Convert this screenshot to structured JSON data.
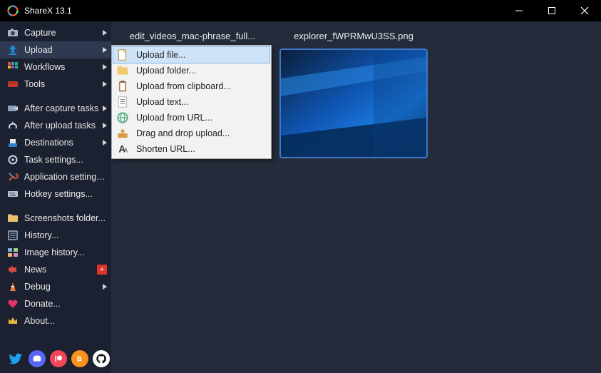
{
  "window": {
    "title": "ShareX 13.1"
  },
  "sidebar": {
    "items": [
      {
        "label": "Capture",
        "icon": "camera-icon",
        "submenu": true
      },
      {
        "label": "Upload",
        "icon": "upload-icon",
        "submenu": true,
        "selected": true
      },
      {
        "label": "Workflows",
        "icon": "workflows-icon",
        "submenu": true
      },
      {
        "label": "Tools",
        "icon": "tools-icon",
        "submenu": true
      }
    ],
    "items2": [
      {
        "label": "After capture tasks",
        "icon": "after-capture-icon",
        "submenu": true
      },
      {
        "label": "After upload tasks",
        "icon": "after-upload-icon",
        "submenu": true
      },
      {
        "label": "Destinations",
        "icon": "destinations-icon",
        "submenu": true
      },
      {
        "label": "Task settings...",
        "icon": "task-settings-icon"
      },
      {
        "label": "Application settings...",
        "icon": "app-settings-icon"
      },
      {
        "label": "Hotkey settings...",
        "icon": "hotkey-settings-icon"
      }
    ],
    "items3": [
      {
        "label": "Screenshots folder...",
        "icon": "folder-icon"
      },
      {
        "label": "History...",
        "icon": "history-icon"
      },
      {
        "label": "Image history...",
        "icon": "image-history-icon"
      },
      {
        "label": "News",
        "icon": "news-icon",
        "badge": "+"
      },
      {
        "label": "Debug",
        "icon": "debug-icon",
        "submenu": true
      },
      {
        "label": "Donate...",
        "icon": "heart-icon"
      },
      {
        "label": "About...",
        "icon": "crown-icon"
      }
    ]
  },
  "submenu": {
    "items": [
      {
        "label": "Upload file...",
        "icon": "file-icon",
        "hover": true
      },
      {
        "label": "Upload folder...",
        "icon": "folder-icon"
      },
      {
        "label": "Upload from clipboard...",
        "icon": "clipboard-icon"
      },
      {
        "label": "Upload text...",
        "icon": "text-icon"
      },
      {
        "label": "Upload from URL...",
        "icon": "url-icon"
      },
      {
        "label": "Drag and drop upload...",
        "icon": "drag-icon"
      },
      {
        "label": "Shorten URL...",
        "icon": "shorten-icon"
      }
    ]
  },
  "files": [
    {
      "name": "edit_videos_mac-phrase_full..."
    },
    {
      "name": "explorer_fWPRMwU3SS.png",
      "selected": true
    }
  ],
  "social": [
    "twitter",
    "discord",
    "patreon",
    "bitcoin",
    "github"
  ],
  "colors": {
    "discord": "#5865F2",
    "twitter": "#1DA1F2",
    "patreon": "#F1465A",
    "bitcoin": "#F7931A",
    "github_bg": "#ffffff"
  }
}
